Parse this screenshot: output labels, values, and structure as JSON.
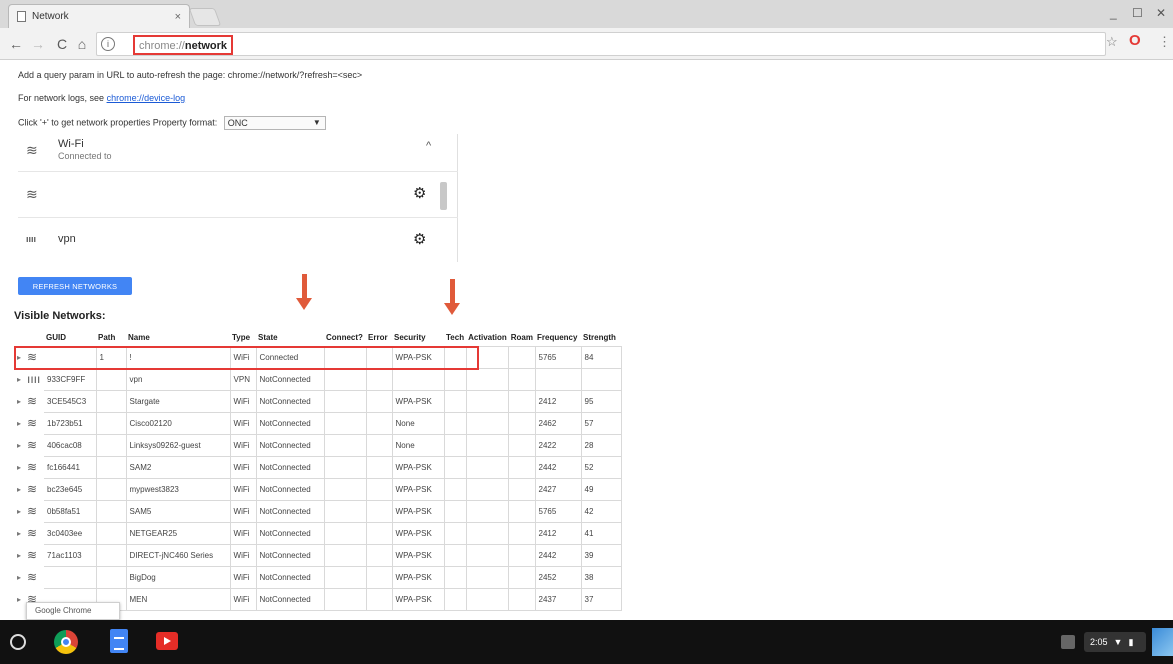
{
  "tab": {
    "title": "Network",
    "close": "×"
  },
  "window": {
    "minimize": "_",
    "maximize": "☐",
    "close": "✕"
  },
  "toolbar": {
    "back": "←",
    "forward": "→",
    "reload": "C",
    "home": "⌂",
    "url_prefix": "chrome://",
    "url_path": "network",
    "star": "☆",
    "opera": "O",
    "menu": "⋮"
  },
  "page": {
    "line1": "Add a query param in URL to auto-refresh the page: chrome://network/?refresh=<sec>",
    "line2_prefix": "For network logs, see",
    "line2_link": "chrome://device-log",
    "line3": "Click '+' to get network properties Property format:",
    "format_select": "ONC"
  },
  "network_list": {
    "wifi_title": "Wi-Fi",
    "wifi_sub": "Connected to",
    "vpn_label": "vpn",
    "vpn_icon": "ıııı"
  },
  "refresh_button": "REFRESH NETWORKS",
  "visible_title": "Visible Networks:",
  "table": {
    "headers": [
      "GUID",
      "Path",
      "Name",
      "Type",
      "State",
      "Connect?",
      "Error",
      "Security",
      "Tech",
      "Activation",
      "Roam",
      "Frequency",
      "Strength"
    ],
    "rows": [
      {
        "icon": "wifi-lock-icon",
        "glyph": "≋",
        "guid": "",
        "path": "1",
        "name": "!",
        "type": "WiFi",
        "state": "Connected",
        "security": "WPA-PSK",
        "frequency": "5765",
        "strength": "84"
      },
      {
        "icon": "vpn-icon",
        "glyph": "ıııı",
        "guid": "933CF9FF",
        "path": "",
        "name": "vpn",
        "type": "VPN",
        "state": "NotConnected",
        "security": "",
        "frequency": "",
        "strength": ""
      },
      {
        "icon": "wifi-lock-icon",
        "glyph": "≋",
        "guid": "3CE545C3",
        "path": "",
        "name": "Stargate",
        "type": "WiFi",
        "state": "NotConnected",
        "security": "WPA-PSK",
        "frequency": "2412",
        "strength": "95"
      },
      {
        "icon": "wifi-icon",
        "glyph": "≋",
        "guid": "1b723b51",
        "path": "",
        "name": "Cisco02120",
        "type": "WiFi",
        "state": "NotConnected",
        "security": "None",
        "frequency": "2462",
        "strength": "57"
      },
      {
        "icon": "wifi-icon",
        "glyph": "≋",
        "guid": "406cac08",
        "path": "",
        "name": "Linksys09262-guest",
        "type": "WiFi",
        "state": "NotConnected",
        "security": "None",
        "frequency": "2422",
        "strength": "28"
      },
      {
        "icon": "wifi-lock-icon",
        "glyph": "≋",
        "guid": "fc166441",
        "path": "",
        "name": "SAM2",
        "type": "WiFi",
        "state": "NotConnected",
        "security": "WPA-PSK",
        "frequency": "2442",
        "strength": "52"
      },
      {
        "icon": "wifi-lock-icon",
        "glyph": "≋",
        "guid": "bc23e645",
        "path": "",
        "name": "mypwest3823",
        "type": "WiFi",
        "state": "NotConnected",
        "security": "WPA-PSK",
        "frequency": "2427",
        "strength": "49"
      },
      {
        "icon": "wifi-lock-icon",
        "glyph": "≋",
        "guid": "0b58fa51",
        "path": "",
        "name": "SAM5",
        "type": "WiFi",
        "state": "NotConnected",
        "security": "WPA-PSK",
        "frequency": "5765",
        "strength": "42"
      },
      {
        "icon": "wifi-lock-icon",
        "glyph": "≋",
        "guid": "3c0403ee",
        "path": "",
        "name": "NETGEAR25",
        "type": "WiFi",
        "state": "NotConnected",
        "security": "WPA-PSK",
        "frequency": "2412",
        "strength": "41"
      },
      {
        "icon": "wifi-lock-icon",
        "glyph": "≋",
        "guid": "71ac1103",
        "path": "",
        "name": "DIRECT-jNC460 Series",
        "type": "WiFi",
        "state": "NotConnected",
        "security": "WPA-PSK",
        "frequency": "2442",
        "strength": "39"
      },
      {
        "icon": "wifi-lock-icon",
        "glyph": "≋",
        "guid": "",
        "path": "",
        "name": "BigDog",
        "type": "WiFi",
        "state": "NotConnected",
        "security": "WPA-PSK",
        "frequency": "2452",
        "strength": "38"
      },
      {
        "icon": "wifi-lock-icon",
        "glyph": "≋",
        "guid": "",
        "path": "",
        "name": "MEN",
        "type": "WiFi",
        "state": "NotConnected",
        "security": "WPA-PSK",
        "frequency": "2437",
        "strength": "37"
      }
    ]
  },
  "tooltip": "Google Chrome",
  "shelf": {
    "time": "2:05"
  },
  "colors": {
    "highlight": "#e53935",
    "arrow": "#e05a3a",
    "button": "#4285f4",
    "link": "#1a5ad6"
  }
}
